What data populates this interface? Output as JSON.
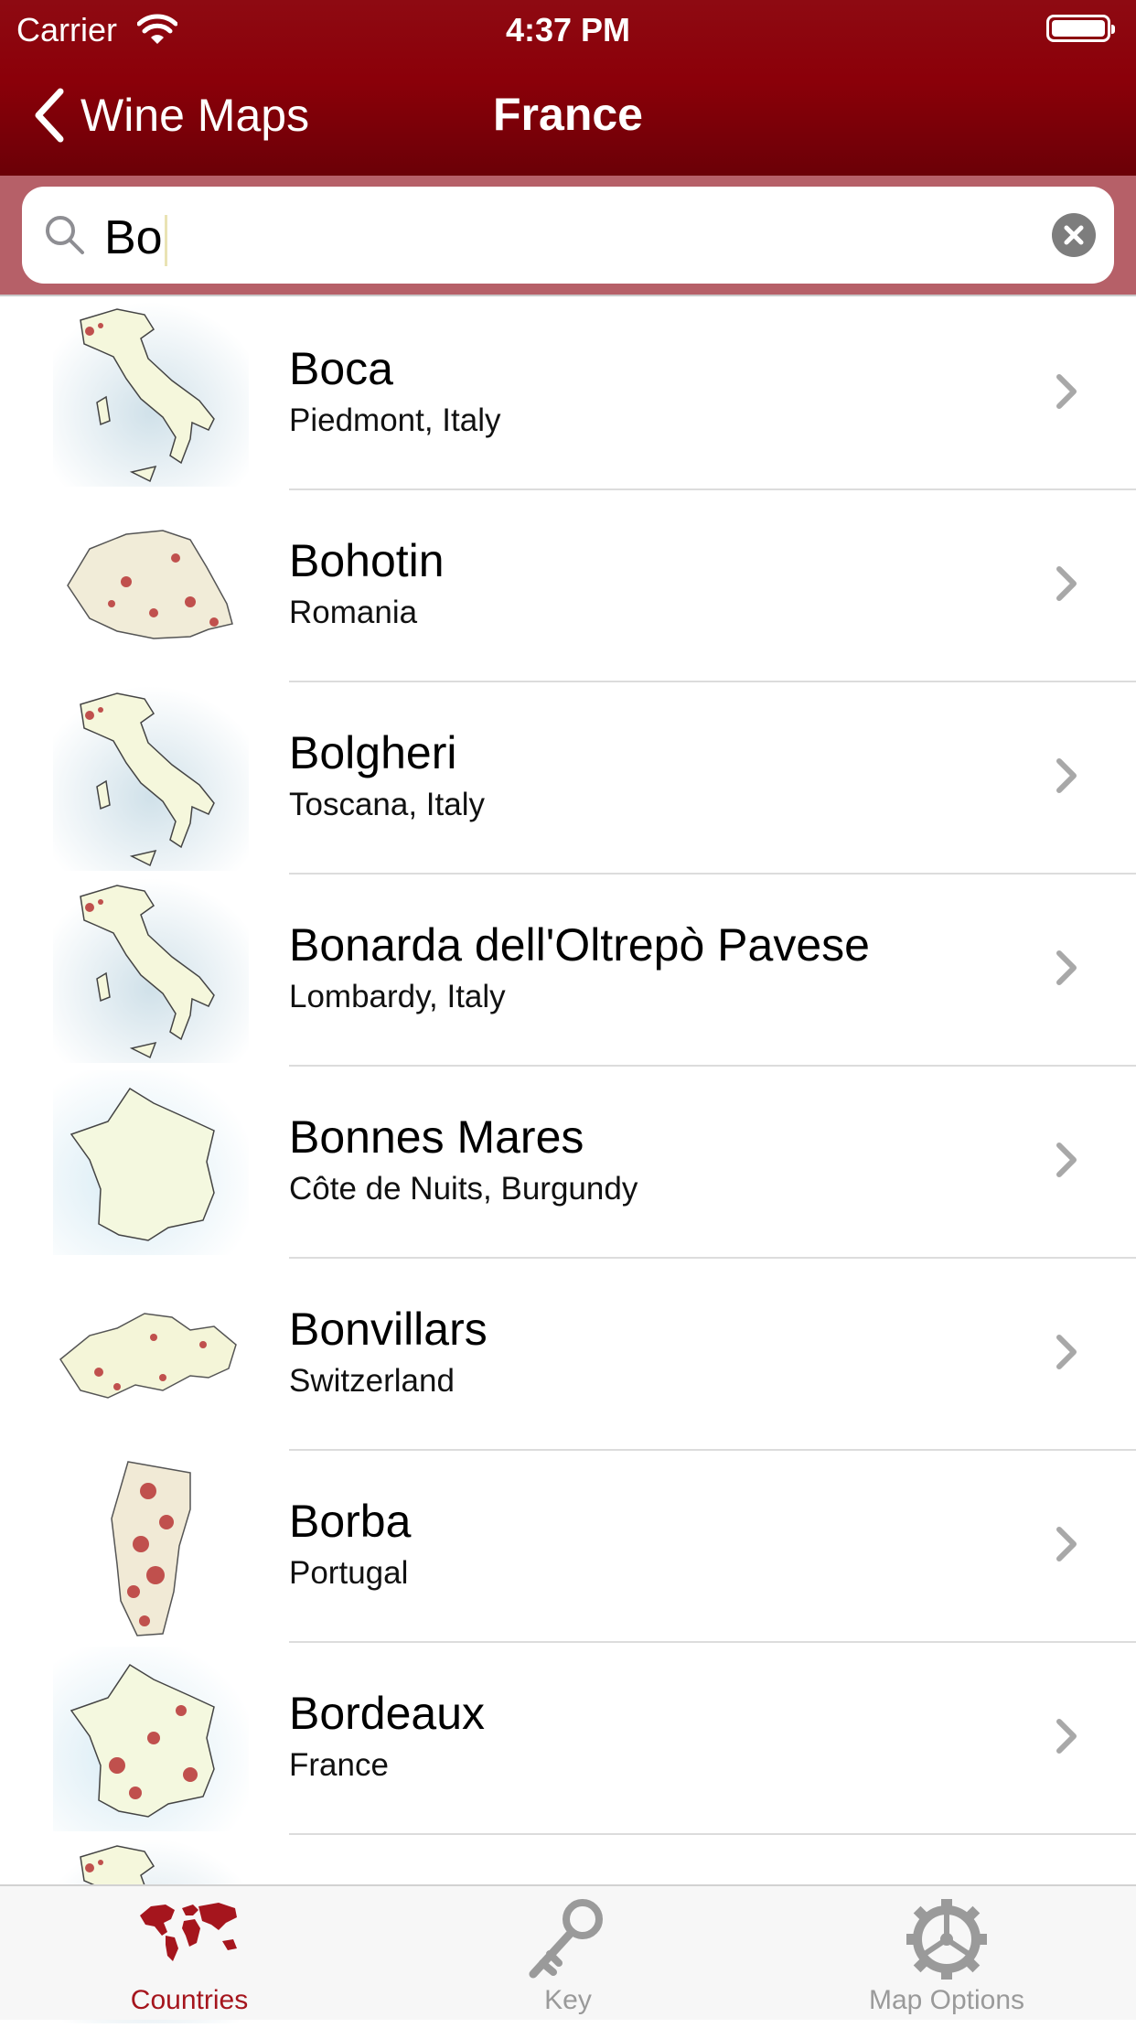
{
  "status_bar": {
    "carrier": "Carrier",
    "time": "4:37 PM"
  },
  "nav": {
    "back_label": "Wine Maps",
    "title": "France"
  },
  "search": {
    "value": "Bo"
  },
  "results": [
    {
      "name": "Boca",
      "region": "Piedmont, Italy",
      "map": "italy"
    },
    {
      "name": "Bohotin",
      "region": "Romania",
      "map": "romania"
    },
    {
      "name": "Bolgheri",
      "region": "Toscana, Italy",
      "map": "italy"
    },
    {
      "name": "Bonarda dell'Oltrepò Pavese",
      "region": "Lombardy, Italy",
      "map": "italy"
    },
    {
      "name": "Bonnes Mares",
      "region": "Côte de Nuits, Burgundy",
      "map": "france"
    },
    {
      "name": "Bonvillars",
      "region": "Switzerland",
      "map": "switzerland"
    },
    {
      "name": "Borba",
      "region": "Portugal",
      "map": "portugal"
    },
    {
      "name": "Bordeaux",
      "region": "France",
      "map": "france"
    },
    {
      "name": "",
      "region": "",
      "map": "italy"
    }
  ],
  "tabs": [
    {
      "label": "Countries",
      "icon": "world-map-icon",
      "active": true
    },
    {
      "label": "Key",
      "icon": "key-icon",
      "active": false
    },
    {
      "label": "Map Options",
      "icon": "steering-wheel-icon",
      "active": false
    }
  ],
  "colors": {
    "nav_red": "#8b0009",
    "search_bar": "#b66068",
    "tab_active": "#a5151d",
    "tab_inactive": "#9a9a9a"
  }
}
